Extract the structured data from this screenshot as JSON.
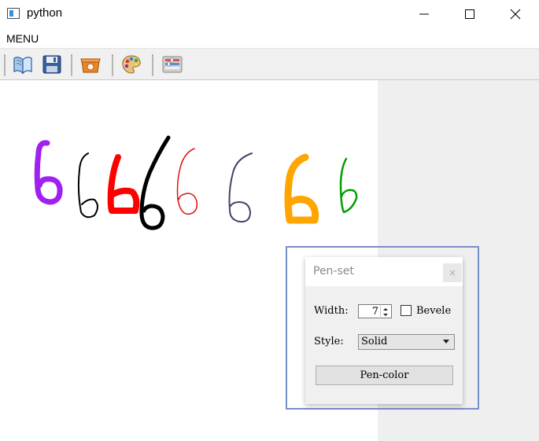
{
  "window": {
    "title": "python",
    "icons": {
      "app": "app-window-icon",
      "minimize": "minimize-icon",
      "maximize": "maximize-icon",
      "close": "close-icon"
    }
  },
  "menu": {
    "items": [
      {
        "label": "MENU"
      }
    ]
  },
  "toolbar": {
    "buttons": [
      {
        "icon": "open-book-icon"
      },
      {
        "icon": "save-floppy-icon"
      },
      {
        "icon": "clear-trash-box-icon"
      },
      {
        "icon": "color-palette-icon"
      },
      {
        "icon": "settings-panel-icon"
      }
    ]
  },
  "canvas": {
    "strokes": [
      {
        "color": "#a020f0"
      },
      {
        "color": "#000000"
      },
      {
        "color": "#ff0000"
      },
      {
        "color": "#000000"
      },
      {
        "color": "#e01010"
      },
      {
        "color": "#4a3f6b"
      },
      {
        "color": "#ffa500"
      },
      {
        "color": "#00a000"
      }
    ]
  },
  "dialog": {
    "title": "Pen-set",
    "close_label": "×",
    "width_label": "Width:",
    "width_value": "7",
    "bevel_label": "Bevele",
    "bevel_checked": false,
    "style_label": "Style:",
    "style_value": "Solid",
    "pen_color_button": "Pen-color"
  },
  "colors": {
    "highlight": "#7590c6",
    "toolbar_bg": "#f0f0f0",
    "right_pane": "#efefef"
  }
}
